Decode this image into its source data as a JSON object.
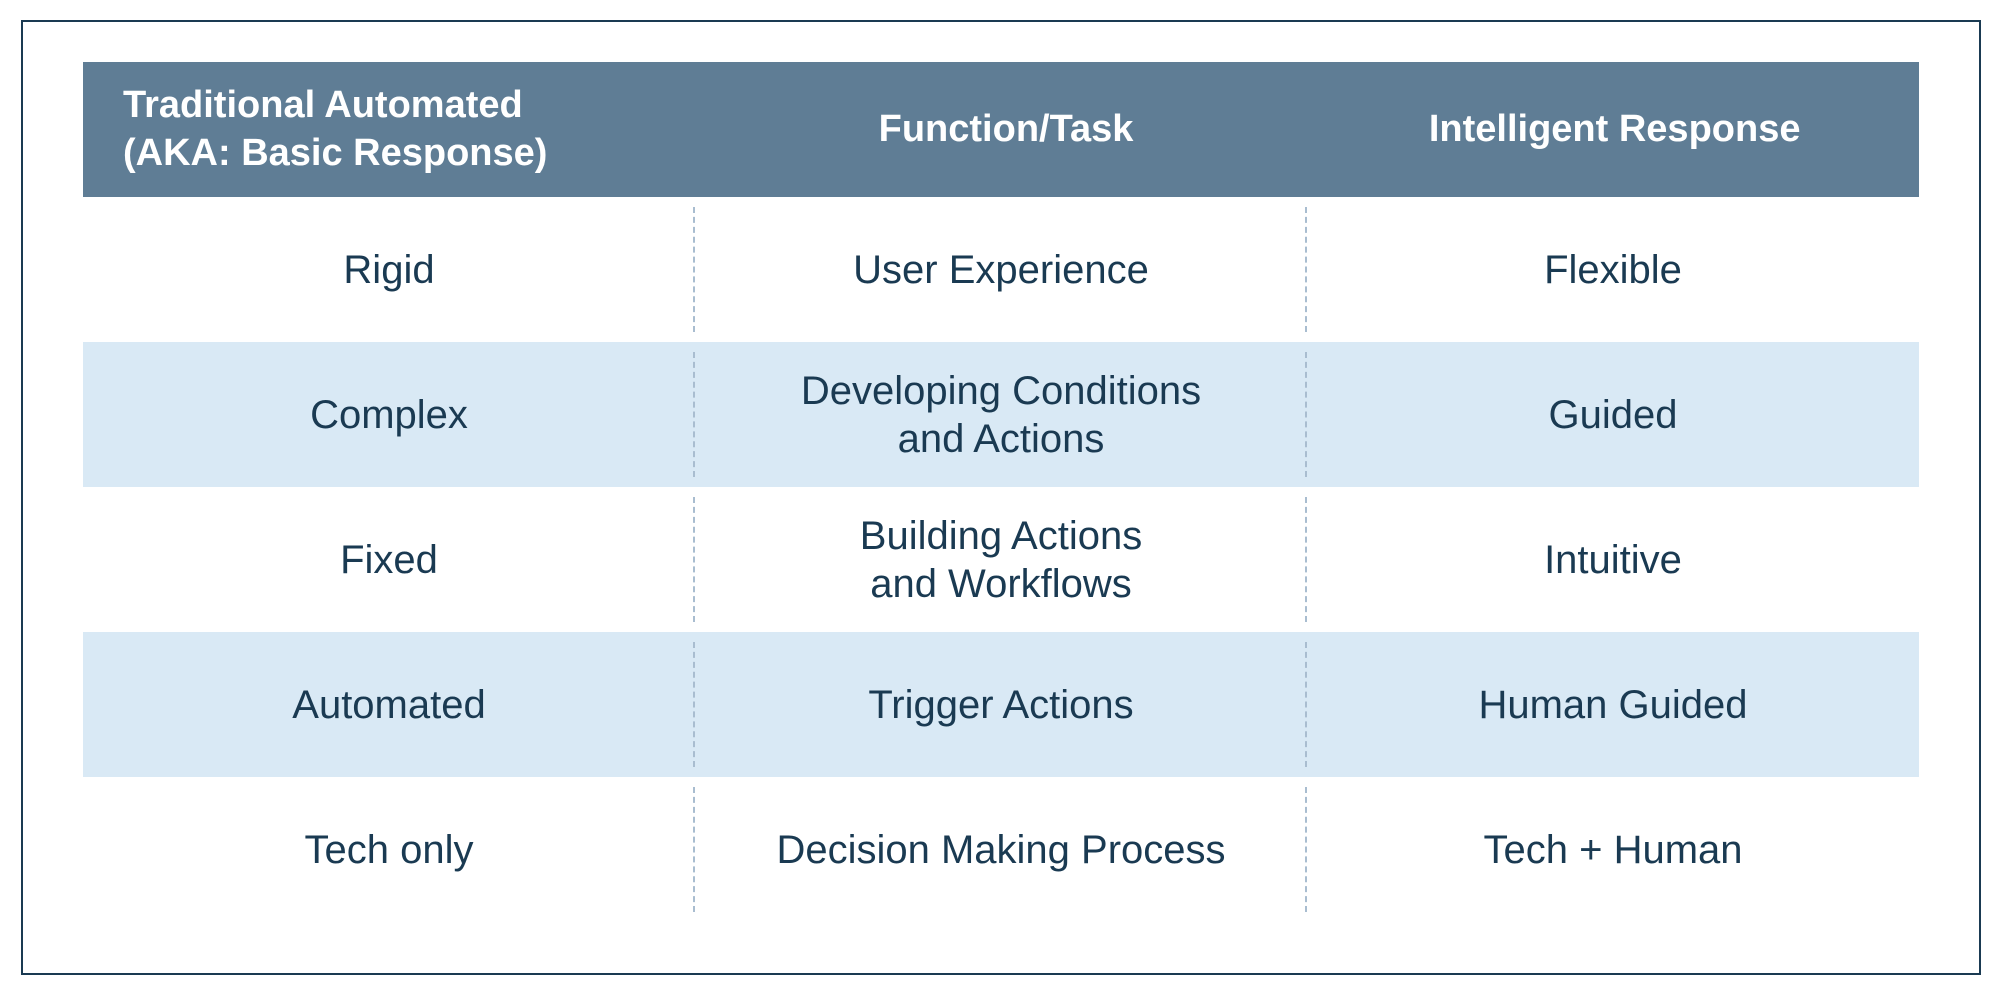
{
  "chart_data": {
    "type": "table",
    "columns": [
      "Traditional Automated (AKA: Basic Response)",
      "Function/Task",
      "Intelligent Response"
    ],
    "rows": [
      [
        "Rigid",
        "User Experience",
        "Flexible"
      ],
      [
        "Complex",
        "Developing Conditions and Actions",
        "Guided"
      ],
      [
        "Fixed",
        "Building Actions and Workflows",
        "Intuitive"
      ],
      [
        "Automated",
        "Trigger Actions",
        "Human Guided"
      ],
      [
        "Tech only",
        "Decision Making Process",
        "Tech + Human"
      ]
    ]
  },
  "table": {
    "headers": {
      "col1_line1": "Traditional Automated",
      "col1_line2": "(AKA: Basic Response)",
      "col2": "Function/Task",
      "col3": "Intelligent Response"
    },
    "rows": [
      {
        "c1": "Rigid",
        "c2_l1": "User Experience",
        "c2_l2": "",
        "c3": "Flexible"
      },
      {
        "c1": "Complex",
        "c2_l1": "Developing Conditions",
        "c2_l2": "and Actions",
        "c3": "Guided"
      },
      {
        "c1": "Fixed",
        "c2_l1": "Building Actions",
        "c2_l2": "and Workflows",
        "c3": "Intuitive"
      },
      {
        "c1": "Automated",
        "c2_l1": "Trigger Actions",
        "c2_l2": "",
        "c3": "Human Guided"
      },
      {
        "c1": "Tech only",
        "c2_l1": "Decision Making Process",
        "c2_l2": "",
        "c3": "Tech + Human"
      }
    ]
  }
}
